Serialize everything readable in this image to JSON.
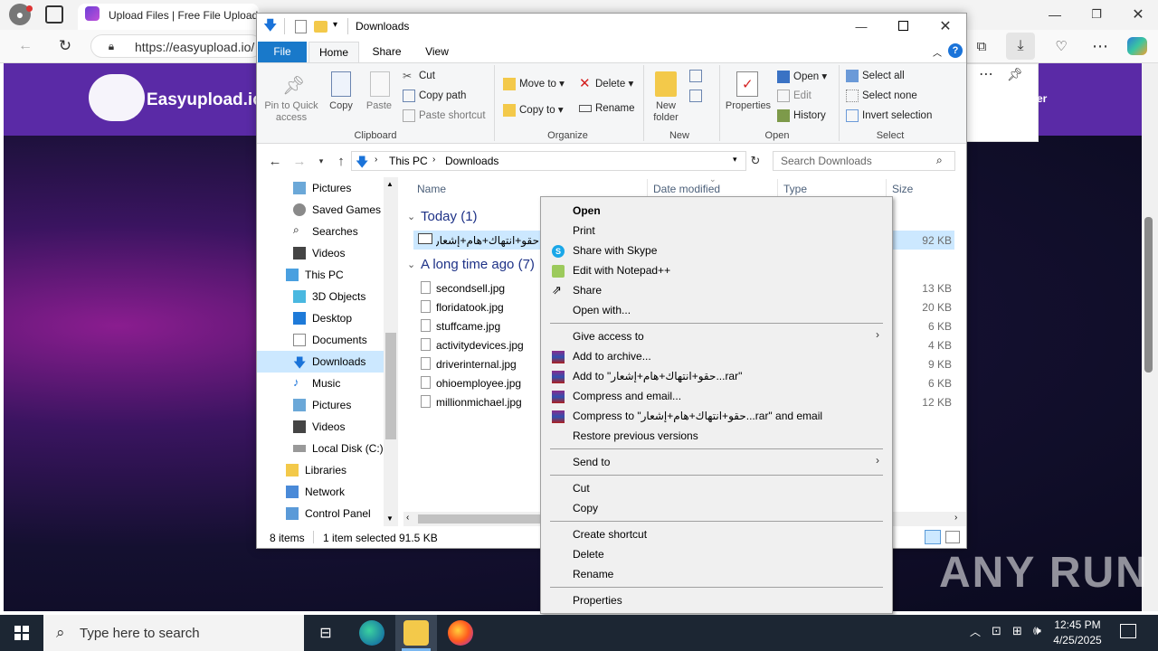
{
  "browser": {
    "tab_title": "Upload Files | Free File Upload a",
    "url": "https://easyupload.io/",
    "site_logo_text": "Easyupload.io",
    "partial_text": "er"
  },
  "explorer": {
    "title": "Downloads",
    "ribbon_tabs": [
      "File",
      "Home",
      "Share",
      "View"
    ],
    "clipboard": {
      "pin": "Pin to Quick access",
      "copy": "Copy",
      "paste": "Paste",
      "cut": "Cut",
      "copy_path": "Copy path",
      "paste_shortcut": "Paste shortcut",
      "group": "Clipboard"
    },
    "organize": {
      "move_to": "Move to",
      "copy_to": "Copy to",
      "delete": "Delete",
      "rename": "Rename",
      "group": "Organize"
    },
    "new": {
      "new_folder": "New folder",
      "group": "New"
    },
    "open": {
      "properties": "Properties",
      "open": "Open",
      "edit": "Edit",
      "history": "History",
      "group": "Open"
    },
    "select": {
      "select_all": "Select all",
      "select_none": "Select none",
      "invert": "Invert selection",
      "group": "Select"
    },
    "breadcrumb": [
      "This PC",
      "Downloads"
    ],
    "search_placeholder": "Search Downloads",
    "nav_items": [
      "Pictures",
      "Saved Games",
      "Searches",
      "Videos",
      "This PC",
      "3D Objects",
      "Desktop",
      "Documents",
      "Downloads",
      "Music",
      "Pictures",
      "Videos",
      "Local Disk (C:)",
      "Libraries",
      "Network",
      "Control Panel"
    ],
    "columns": {
      "name": "Name",
      "date": "Date modified",
      "type": "Type",
      "size": "Size"
    },
    "group_today": "Today (1)",
    "group_old": "A long time ago (7)",
    "selected_file": {
      "name": "حقو+انتهاك+هام+إشعار",
      "size": "92 KB"
    },
    "files": [
      {
        "name": "secondsell.jpg",
        "size": "13 KB"
      },
      {
        "name": "floridatook.jpg",
        "size": "20 KB"
      },
      {
        "name": "stuffcame.jpg",
        "size": "6 KB"
      },
      {
        "name": "activitydevices.jpg",
        "size": "4 KB"
      },
      {
        "name": "driverinternal.jpg",
        "size": "9 KB"
      },
      {
        "name": "ohioemployee.jpg",
        "size": "6 KB"
      },
      {
        "name": "millionmichael.jpg",
        "size": "12 KB"
      }
    ],
    "status": {
      "count": "8 items",
      "selected": "1 item selected",
      "size": "91.5 KB"
    }
  },
  "context_menu": {
    "open": "Open",
    "print": "Print",
    "skype": "Share with Skype",
    "notepad": "Edit with Notepad++",
    "share": "Share",
    "open_with": "Open with...",
    "give_access": "Give access to",
    "add_archive": "Add to archive...",
    "add_rar": "Add to \"حقو+انتهاك+هام+إشعار...rar\"",
    "compress_email": "Compress and email...",
    "compress_rar_email": "Compress to \"حقو+انتهاك+هام+إشعار...rar\" and email",
    "restore": "Restore previous versions",
    "send_to": "Send to",
    "cut": "Cut",
    "copy": "Copy",
    "create_shortcut": "Create shortcut",
    "delete": "Delete",
    "rename": "Rename",
    "properties": "Properties"
  },
  "taskbar": {
    "search_placeholder": "Type here to search",
    "time": "12:45 PM",
    "date": "4/25/2025"
  },
  "watermark": "ANY RUN"
}
